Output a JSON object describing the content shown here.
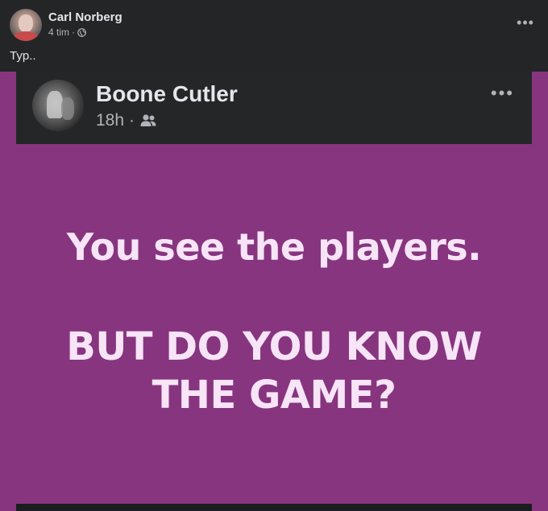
{
  "post": {
    "author": "Carl Norberg",
    "time": "4 tim",
    "separator": "·",
    "privacy_icon": "globe-icon",
    "text": "Typ..",
    "more_icon": "more-options-icon",
    "more_label": "•••"
  },
  "shared": {
    "author": "Boone Cutler",
    "time": "18h",
    "separator": "·",
    "audience_icon": "friends-icon",
    "more_label": "•••",
    "background_color": "#87357f",
    "message_line1": "You see the players.",
    "message_line2a": "BUT DO YOU KNOW",
    "message_line2b": "THE GAME?"
  }
}
